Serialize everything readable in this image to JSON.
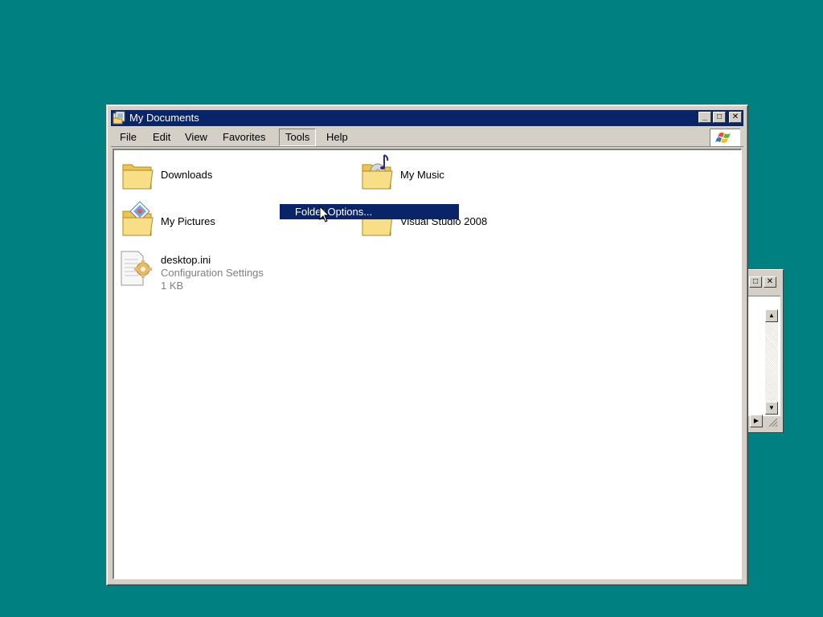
{
  "window": {
    "title": "My Documents",
    "title_icon": "folder-documents-icon"
  },
  "titlebar_buttons": {
    "minimize": "_",
    "maximize": "□",
    "close": "✕"
  },
  "menu": {
    "items": [
      {
        "label": "File"
      },
      {
        "label": "Edit"
      },
      {
        "label": "View"
      },
      {
        "label": "Favorites"
      },
      {
        "label": "Tools"
      },
      {
        "label": "Help"
      }
    ],
    "active": "Tools"
  },
  "files": [
    {
      "name": "Downloads",
      "icon": "folder-icon"
    },
    {
      "name": "My Music",
      "icon": "music-folder-icon"
    },
    {
      "name": "My Pictures",
      "icon": "pictures-folder-icon"
    },
    {
      "name": "Visual Studio 2008",
      "icon": "folder-icon"
    },
    {
      "name": "desktop.ini",
      "type": "Configuration Settings",
      "size": "1 KB",
      "icon": "settings-file-icon"
    }
  ],
  "dropdown": {
    "highlighted_item": "Folder Options..."
  },
  "colors": {
    "desktop": "#008080",
    "titlebar": "#0a246a",
    "chrome": "#d4d0c8",
    "selection": "#0a246a"
  }
}
